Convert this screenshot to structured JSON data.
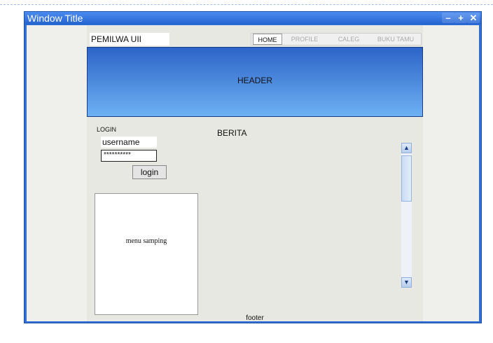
{
  "window": {
    "title": "Window Title",
    "controls": {
      "minimize": "–",
      "maximize": "+",
      "close": "✕"
    }
  },
  "site": {
    "title": "PEMILWA UII",
    "nav": {
      "tabs": [
        "HOME",
        "PROFILE",
        "CALEG",
        "BUKU TAMU"
      ],
      "active_index": 0
    },
    "header": "HEADER",
    "login": {
      "label": "LOGIN",
      "username_value": "username",
      "password_value": "**********",
      "button": "login"
    },
    "side_menu": "menu samping",
    "content_title": "BERITA",
    "footer": "footer"
  },
  "scrollbar": {
    "up_icon": "chevron-up-icon",
    "down_icon": "chevron-down-icon"
  },
  "colors": {
    "window_frame": "#2f6fd6",
    "header_top": "#2d64c8",
    "header_bottom": "#6db1f3"
  }
}
